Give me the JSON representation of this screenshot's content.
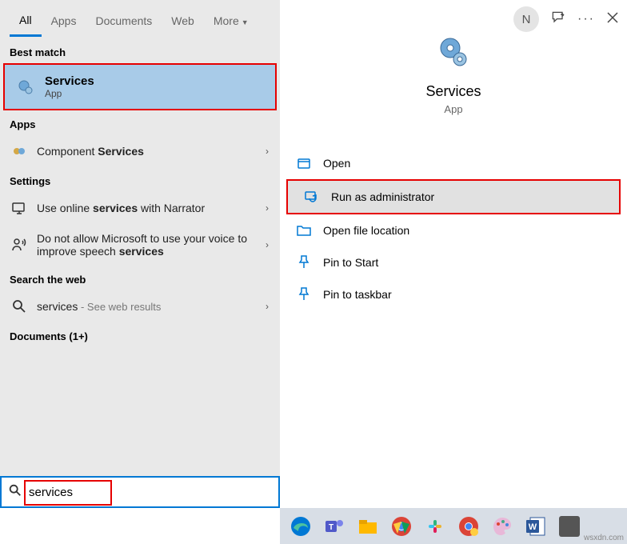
{
  "tabs": {
    "all": "All",
    "apps": "Apps",
    "documents": "Documents",
    "web": "Web",
    "more": "More"
  },
  "avatar_initial": "N",
  "sections": {
    "best_match": "Best match",
    "apps": "Apps",
    "settings": "Settings",
    "search_web": "Search the web",
    "documents": "Documents (1+)"
  },
  "best_match": {
    "title": "Services",
    "subtitle": "App"
  },
  "apps_list": {
    "prefix": "Component ",
    "bold": "Services"
  },
  "settings_list": [
    {
      "pre": "Use online ",
      "bold": "services",
      "post": " with Narrator"
    },
    {
      "pre": "Do not allow Microsoft to use your voice to improve speech ",
      "bold": "services",
      "post": ""
    }
  ],
  "web": {
    "term": "services",
    "hint": " - See web results"
  },
  "details": {
    "title": "Services",
    "subtitle": "App"
  },
  "actions": {
    "open": "Open",
    "run_admin": "Run as administrator",
    "open_loc": "Open file location",
    "pin_start": "Pin to Start",
    "pin_taskbar": "Pin to taskbar"
  },
  "search_value": "services",
  "watermark": "wsxdn.com"
}
